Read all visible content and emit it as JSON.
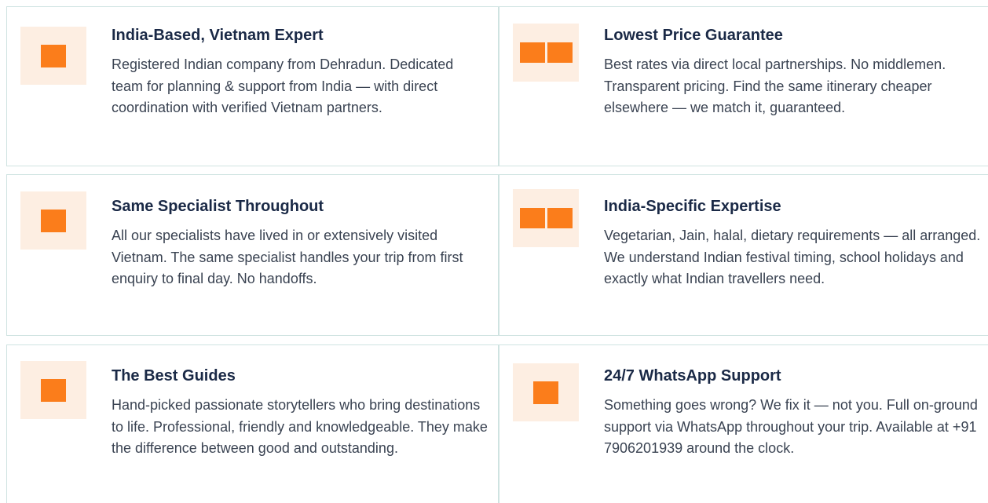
{
  "features": [
    {
      "title": "India-Based, Vietnam Expert",
      "desc": "Registered Indian company from Dehradun. Dedicated team for planning & support from India — with direct coordination with verified Vietnam partners.",
      "icon": "single-square-icon"
    },
    {
      "title": "Lowest Price Guarantee",
      "desc": "Best rates via direct local partnerships. No middlemen. Transparent pricing. Find the same itinerary cheaper elsewhere — we match it, guaranteed.",
      "icon": "double-square-icon"
    },
    {
      "title": "Same Specialist Throughout",
      "desc": "All our specialists have lived in or extensively visited Vietnam. The same specialist handles your trip from first enquiry to final day. No handoffs.",
      "icon": "single-square-icon"
    },
    {
      "title": "India-Specific Expertise",
      "desc": "Vegetarian, Jain, halal, dietary requirements — all arranged. We understand Indian festival timing, school holidays and exactly what Indian travellers need.",
      "icon": "double-square-icon"
    },
    {
      "title": "The Best Guides",
      "desc": "Hand-picked passionate storytellers who bring destinations to life. Professional, friendly and knowledgeable. They make the difference between good and outstanding.",
      "icon": "single-square-icon"
    },
    {
      "title": "24/7 WhatsApp Support",
      "desc": "Something goes wrong? We fix it — not you. Full on-ground support via WhatsApp throughout your trip. Available at +91 7906201939 around the clock.",
      "icon": "single-square-icon"
    }
  ],
  "colors": {
    "accent": "#fb7d1b",
    "icon_bg": "#fdeee2",
    "title": "#1a2946",
    "text": "#3a4352",
    "border": "#cfe3e1"
  }
}
